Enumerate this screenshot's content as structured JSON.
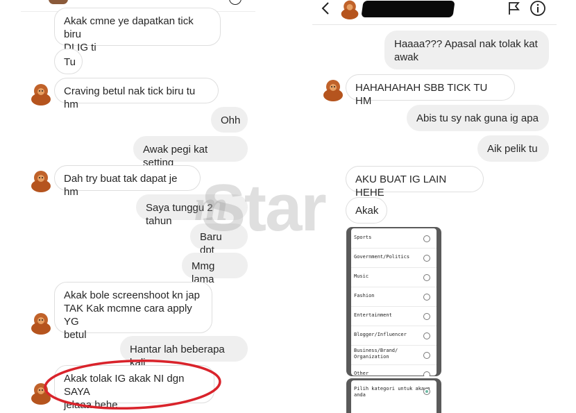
{
  "left_chat": {
    "messages": [
      {
        "side": "recv",
        "text": "Akak cmne ye dapatkan tick biru\nDI IG ti"
      },
      {
        "side": "recv",
        "text": "Tu"
      },
      {
        "side": "recv",
        "text": "Craving betul nak tick biru tu hm"
      },
      {
        "side": "sent",
        "text": "Ohh"
      },
      {
        "side": "sent",
        "text": "Awak pegi kat setting"
      },
      {
        "side": "recv",
        "text": "Dah try buat tak dapat je hm"
      },
      {
        "side": "sent",
        "text": "Saya tunggu 2 tahun"
      },
      {
        "side": "sent",
        "text": "Baru dpt"
      },
      {
        "side": "sent",
        "text": "Mmg lama"
      },
      {
        "side": "recv",
        "text": "Akak bole screenshoot kn jap\nTAK Kak mcmne cara apply YG\nbetul"
      },
      {
        "side": "sent",
        "text": "Hantar lah beberapa kali"
      },
      {
        "side": "recv",
        "text": "Akak tolak IG akak NI dgn SAYA\njelaaa hehe"
      }
    ]
  },
  "right_chat": {
    "header": {
      "back_icon": "chevron-left-icon",
      "flag_icon": "flag-icon",
      "info_icon": "info-icon"
    },
    "messages": [
      {
        "side": "sent",
        "text": "Haaaa??? Apasal nak tolak kat\nawak"
      },
      {
        "side": "recv",
        "text": "HAHAHAHAH SBB TICK TU HM"
      },
      {
        "side": "sent",
        "text": "Abis tu sy nak guna ig apa"
      },
      {
        "side": "sent",
        "text": "Aik pelik tu"
      },
      {
        "side": "recv",
        "text": "AKU BUAT IG LAIN HEHE"
      },
      {
        "side": "recv",
        "text": "Akak"
      }
    ],
    "category_screenshot": {
      "items": [
        {
          "label": "Sports",
          "checked": false
        },
        {
          "label": "Government/Politics",
          "checked": false
        },
        {
          "label": "Music",
          "checked": false
        },
        {
          "label": "Fashion",
          "checked": false
        },
        {
          "label": "Entertainment",
          "checked": false
        },
        {
          "label": "Blogger/Influencer",
          "checked": false
        },
        {
          "label": "Business/Brand/\nOrganization",
          "checked": false
        },
        {
          "label": "Other",
          "checked": false
        }
      ],
      "picker_label": "Pilih kategori untuk akaun\nanda",
      "picker_checked": true
    }
  },
  "watermark": {
    "text": "Star",
    "prefix": "m"
  },
  "colors": {
    "sent_bubble": "#efefef",
    "recv_border": "#dedede",
    "highlight_circle": "#d9232b",
    "redaction": "#0a0a0a"
  }
}
